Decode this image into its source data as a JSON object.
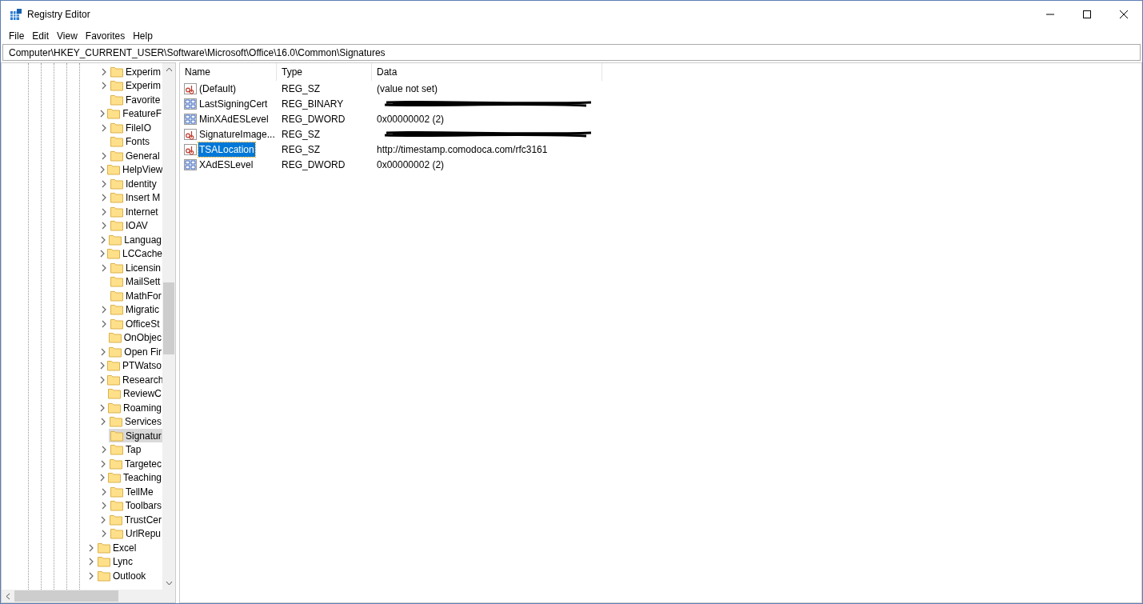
{
  "window": {
    "title": "Registry Editor"
  },
  "menu": [
    "File",
    "Edit",
    "View",
    "Favorites",
    "Help"
  ],
  "address": "Computer\\HKEY_CURRENT_USER\\Software\\Microsoft\\Office\\16.0\\Common\\Signatures",
  "tree": [
    {
      "children": [
        {
          "label": "Experim",
          "expandable": true,
          "selected": false
        },
        {
          "label": "Experim",
          "expandable": true,
          "selected": false
        },
        {
          "label": "Favorite",
          "expandable": false,
          "selected": false
        },
        {
          "label": "FeatureF",
          "expandable": true,
          "selected": false
        },
        {
          "label": "FileIO",
          "expandable": true,
          "selected": false
        },
        {
          "label": "Fonts",
          "expandable": false,
          "selected": false
        },
        {
          "label": "General",
          "expandable": true,
          "selected": false
        },
        {
          "label": "HelpView",
          "expandable": true,
          "selected": false
        },
        {
          "label": "Identity",
          "expandable": true,
          "selected": false
        },
        {
          "label": "Insert M",
          "expandable": true,
          "selected": false
        },
        {
          "label": "Internet",
          "expandable": true,
          "selected": false
        },
        {
          "label": "IOAV",
          "expandable": true,
          "selected": false
        },
        {
          "label": "Languag",
          "expandable": true,
          "selected": false
        },
        {
          "label": "LCCache",
          "expandable": true,
          "selected": false
        },
        {
          "label": "Licensin",
          "expandable": true,
          "selected": false
        },
        {
          "label": "MailSett",
          "expandable": false,
          "selected": false
        },
        {
          "label": "MathFor",
          "expandable": false,
          "selected": false
        },
        {
          "label": "Migratic",
          "expandable": true,
          "selected": false
        },
        {
          "label": "OfficeSt",
          "expandable": true,
          "selected": false
        },
        {
          "label": "OnObjec",
          "expandable": false,
          "selected": false
        },
        {
          "label": "Open Fir",
          "expandable": true,
          "selected": false
        },
        {
          "label": "PTWatso",
          "expandable": true,
          "selected": false
        },
        {
          "label": "Research",
          "expandable": true,
          "selected": false
        },
        {
          "label": "ReviewC",
          "expandable": false,
          "selected": false
        },
        {
          "label": "Roaming",
          "expandable": true,
          "selected": false
        },
        {
          "label": "Services",
          "expandable": true,
          "selected": false
        },
        {
          "label": "Signatur",
          "expandable": false,
          "selected": true
        },
        {
          "label": "Tap",
          "expandable": true,
          "selected": false
        },
        {
          "label": "Targetec",
          "expandable": true,
          "selected": false
        },
        {
          "label": "Teaching",
          "expandable": true,
          "selected": false
        },
        {
          "label": "TellMe",
          "expandable": true,
          "selected": false
        },
        {
          "label": "Toolbars",
          "expandable": true,
          "selected": false
        },
        {
          "label": "TrustCer",
          "expandable": true,
          "selected": false
        },
        {
          "label": "UrlRepu",
          "expandable": true,
          "selected": false
        }
      ]
    },
    {
      "label": "Excel",
      "expandable": true,
      "selected": false
    },
    {
      "label": "Lync",
      "expandable": true,
      "selected": false
    },
    {
      "label": "Outlook",
      "expandable": true,
      "selected": false
    }
  ],
  "table": {
    "columns": [
      "Name",
      "Type",
      "Data"
    ],
    "rows": [
      {
        "name": "(Default)",
        "type": "REG_SZ",
        "data": "(value not set)",
        "kind": "string",
        "redacted": false,
        "selected": false
      },
      {
        "name": "LastSigningCert",
        "type": "REG_BINARY",
        "kind": "binary",
        "redacted": true,
        "selected": false
      },
      {
        "name": "MinXAdESLevel",
        "type": "REG_DWORD",
        "data": "0x00000002 (2)",
        "kind": "binary",
        "redacted": false,
        "selected": false
      },
      {
        "name": "SignatureImage...",
        "type": "REG_SZ",
        "kind": "string",
        "redacted": true,
        "selected": false
      },
      {
        "name": "TSALocation",
        "type": "REG_SZ",
        "data": "http://timestamp.comodoca.com/rfc3161",
        "kind": "string",
        "redacted": false,
        "selected": true
      },
      {
        "name": "XAdESLevel",
        "type": "REG_DWORD",
        "data": "0x00000002 (2)",
        "kind": "binary",
        "redacted": false,
        "selected": false
      }
    ]
  }
}
